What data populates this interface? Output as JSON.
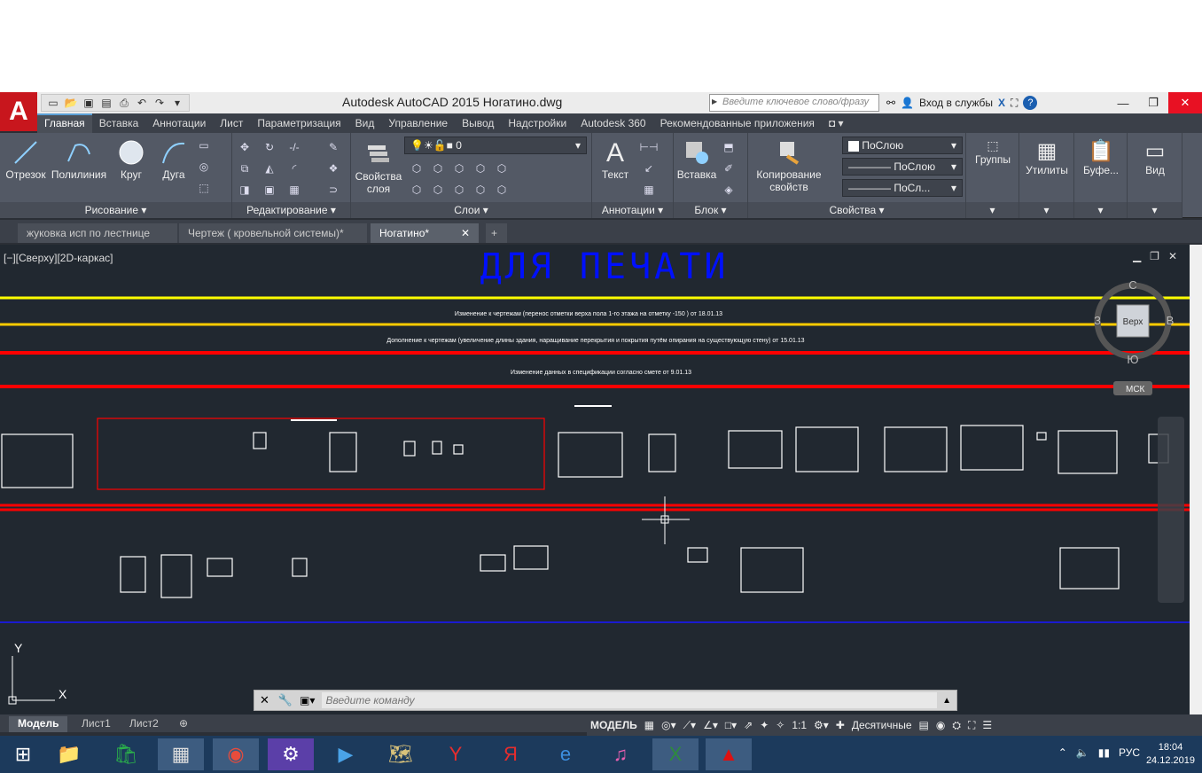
{
  "window": {
    "title": "Autodesk AutoCAD 2015    Ногатино.dwg",
    "search_placeholder": "Введите ключевое слово/фразу",
    "signin": "Вход в службы"
  },
  "ribbon_tabs": [
    "Главная",
    "Вставка",
    "Аннотации",
    "Лист",
    "Параметризация",
    "Вид",
    "Управление",
    "Вывод",
    "Надстройки",
    "Autodesk 360",
    "Рекомендованные приложения"
  ],
  "ribbon": {
    "draw": {
      "title": "Рисование ▾",
      "line": "Отрезок",
      "polyline": "Полилиния",
      "circle": "Круг",
      "arc": "Дуга"
    },
    "modify": {
      "title": "Редактирование ▾"
    },
    "layers": {
      "title": "Слои ▾",
      "props": "Свойства слоя",
      "current_layer": "0"
    },
    "annotation": {
      "title": "Аннотации ▾",
      "text": "Текст"
    },
    "block": {
      "title": "Блок ▾",
      "insert": "Вставка"
    },
    "properties": {
      "title": "Свойства ▾",
      "match": "Копирование свойств",
      "color": "ПоСлою",
      "linetype": "ПоСлою",
      "lineweight": "ПоСл..."
    },
    "groups": "Группы",
    "utilities": "Утилиты",
    "clipboard": "Буфе...",
    "view": "Вид"
  },
  "doc_tabs": [
    "жуковка исп по лестнице",
    "Чертеж ( кровельной системы)*",
    "Ногатино*"
  ],
  "viewport": {
    "label": "[−][Сверху][2D-каркас]",
    "heading": "ДЛЯ ПЕЧАТИ",
    "note1": "Изменение к чертежам (перенос отметки верха пола 1-го этажа на отметку -150 ) от 18.01.13",
    "note2": "Дополнение к чертежам (увеличение длины здания, наращивание перекрытия и покрытия путём опирания на существующую стену) от 15.01.13",
    "note3": "Изменение данных в спецификации согласно смете от 9.01.13",
    "viewcube": {
      "n": "С",
      "s": "Ю",
      "w": "З",
      "e": "В",
      "top": "Верх",
      "ucs": "МСК"
    }
  },
  "command": {
    "placeholder": "Введите команду"
  },
  "layout_tabs": [
    "Модель",
    "Лист1",
    "Лист2"
  ],
  "status": {
    "model": "МОДЕЛЬ",
    "scale": "1:1",
    "units": "Десятичные"
  },
  "taskbar": {
    "lang": "РУС",
    "time": "18:04",
    "date": "24.12.2019"
  }
}
